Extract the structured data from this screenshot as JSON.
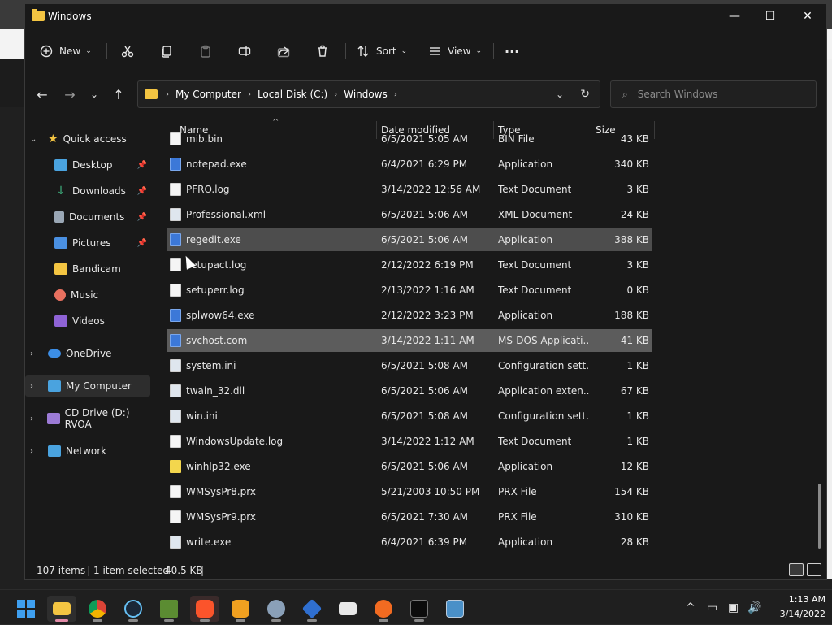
{
  "window": {
    "title": "Windows",
    "minimize": "—",
    "maximize": "☐",
    "close": "✕"
  },
  "toolbar": {
    "new_label": "New",
    "sort_label": "Sort",
    "view_label": "View",
    "more_label": "···"
  },
  "address": {
    "crumbs": [
      "My Computer",
      "Local Disk (C:)",
      "Windows"
    ],
    "search_placeholder": "Search Windows"
  },
  "sidebar": {
    "items": [
      {
        "label": "Quick access",
        "icon": "star-icon",
        "color": "#f4c542"
      },
      {
        "label": "Desktop",
        "icon": "desktop-icon",
        "color": "#4aa3df",
        "pinned": true
      },
      {
        "label": "Downloads",
        "icon": "download-icon",
        "color": "#3fb27f",
        "pinned": true
      },
      {
        "label": "Documents",
        "icon": "documents-icon",
        "color": "#9aa7b5",
        "pinned": true
      },
      {
        "label": "Pictures",
        "icon": "pictures-icon",
        "color": "#4a90e2",
        "pinned": true
      },
      {
        "label": "Bandicam",
        "icon": "folder-icon",
        "color": "#f4c542"
      },
      {
        "label": "Music",
        "icon": "music-icon",
        "color": "#e8705f"
      },
      {
        "label": "Videos",
        "icon": "videos-icon",
        "color": "#8f63d6"
      },
      {
        "label": "OneDrive",
        "icon": "onedrive-icon",
        "color": "#3c8ee6"
      },
      {
        "label": "My Computer",
        "icon": "computer-icon",
        "color": "#4aa3df"
      },
      {
        "label": "CD Drive (D:) RVOA",
        "icon": "cd-drive-icon",
        "color": "#9c7bd6"
      },
      {
        "label": "Network",
        "icon": "network-icon",
        "color": "#4aa3df"
      }
    ]
  },
  "columns": {
    "name": "Name",
    "date": "Date modified",
    "type": "Type",
    "size": "Size"
  },
  "files": [
    {
      "name": "mib.bin",
      "date": "6/5/2021 5:05 AM",
      "type": "BIN File",
      "size": "43 KB",
      "icon": "file-icon"
    },
    {
      "name": "notepad.exe",
      "date": "6/4/2021 6:29 PM",
      "type": "Application",
      "size": "340 KB",
      "icon": "notepad-icon"
    },
    {
      "name": "PFRO.log",
      "date": "3/14/2022 12:56 AM",
      "type": "Text Document",
      "size": "3 KB",
      "icon": "file-icon"
    },
    {
      "name": "Professional.xml",
      "date": "6/5/2021 5:06 AM",
      "type": "XML Document",
      "size": "24 KB",
      "icon": "xml-icon"
    },
    {
      "name": "regedit.exe",
      "date": "6/5/2021 5:06 AM",
      "type": "Application",
      "size": "388 KB",
      "icon": "regedit-icon"
    },
    {
      "name": "setupact.log",
      "date": "2/12/2022 6:19 PM",
      "type": "Text Document",
      "size": "3 KB",
      "icon": "file-icon"
    },
    {
      "name": "setuperr.log",
      "date": "2/13/2022 1:16 AM",
      "type": "Text Document",
      "size": "0 KB",
      "icon": "file-icon"
    },
    {
      "name": "splwow64.exe",
      "date": "2/12/2022 3:23 PM",
      "type": "Application",
      "size": "188 KB",
      "icon": "printer-icon"
    },
    {
      "name": "svchost.com",
      "date": "3/14/2022 1:11 AM",
      "type": "MS-DOS Applicati...",
      "size": "41 KB",
      "icon": "msdos-icon"
    },
    {
      "name": "system.ini",
      "date": "6/5/2021 5:08 AM",
      "type": "Configuration sett...",
      "size": "1 KB",
      "icon": "config-icon"
    },
    {
      "name": "twain_32.dll",
      "date": "6/5/2021 5:06 AM",
      "type": "Application exten...",
      "size": "67 KB",
      "icon": "dll-icon"
    },
    {
      "name": "win.ini",
      "date": "6/5/2021 5:08 AM",
      "type": "Configuration sett...",
      "size": "1 KB",
      "icon": "config-icon"
    },
    {
      "name": "WindowsUpdate.log",
      "date": "3/14/2022 1:12 AM",
      "type": "Text Document",
      "size": "1 KB",
      "icon": "file-icon"
    },
    {
      "name": "winhlp32.exe",
      "date": "6/5/2021 5:06 AM",
      "type": "Application",
      "size": "12 KB",
      "icon": "help-icon"
    },
    {
      "name": "WMSysPr8.prx",
      "date": "5/21/2003 10:50 PM",
      "type": "PRX File",
      "size": "154 KB",
      "icon": "file-icon"
    },
    {
      "name": "WMSysPr9.prx",
      "date": "6/5/2021 7:30 AM",
      "type": "PRX File",
      "size": "310 KB",
      "icon": "file-icon"
    },
    {
      "name": "write.exe",
      "date": "6/4/2021 6:39 PM",
      "type": "Application",
      "size": "28 KB",
      "icon": "write-icon"
    }
  ],
  "status": {
    "items": "107 items",
    "selected": "1 item selected",
    "selected_size": "40.5 KB"
  },
  "clock": {
    "time": "1:13 AM",
    "date": "3/14/2022"
  }
}
